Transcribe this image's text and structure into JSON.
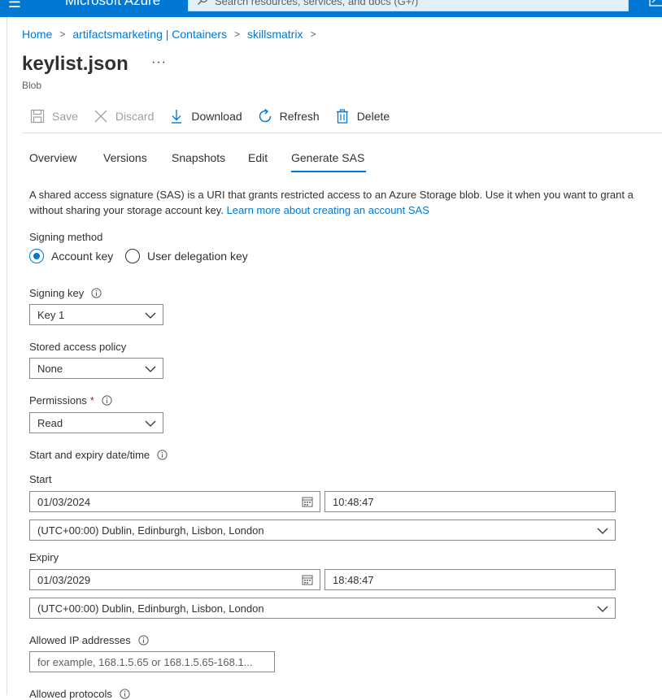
{
  "topbar": {
    "menu_glyph": "☰",
    "brand": "Microsoft Azure",
    "search_placeholder": "Search resources, services, and docs (G+/)",
    "icons": [
      "menu-icon",
      "search-icon",
      "cloud-shell-icon"
    ],
    "color": "#0078d4"
  },
  "breadcrumb": {
    "items": [
      "Home",
      "artifactsmarketing | Containers",
      "skillsmatrix"
    ],
    "separator": ">"
  },
  "header": {
    "title": "keylist.json",
    "more": "···",
    "subtitle": "Blob"
  },
  "toolbar": {
    "save": "Save",
    "discard": "Discard",
    "download": "Download",
    "refresh": "Refresh",
    "delete": "Delete"
  },
  "tabs": {
    "overview": "Overview",
    "versions": "Versions",
    "snapshots": "Snapshots",
    "edit": "Edit",
    "generate_sas": "Generate SAS",
    "active": "Generate SAS"
  },
  "description": {
    "line1": "A shared access signature (SAS) is a URI that grants restricted access to an Azure Storage blob. Use it when you want to grant a",
    "line2_prefix": "without sharing your storage account key. ",
    "link": "Learn more about creating an account SAS"
  },
  "form": {
    "signing_method": {
      "label": "Signing method",
      "options": [
        "Account key",
        "User delegation key"
      ],
      "selected": "Account key"
    },
    "signing_key": {
      "label": "Signing key",
      "value": "Key 1"
    },
    "stored_policy": {
      "label": "Stored access policy",
      "value": "None"
    },
    "permissions": {
      "label": "Permissions",
      "required": "*",
      "value": "Read"
    },
    "datetime": {
      "label": "Start and expiry date/time",
      "start_label": "Start",
      "start_date": "01/03/2024",
      "start_time": "10:48:47",
      "start_tz": "(UTC+00:00) Dublin, Edinburgh, Lisbon, London",
      "expiry_label": "Expiry",
      "expiry_date": "01/03/2029",
      "expiry_time": "18:48:47",
      "expiry_tz": "(UTC+00:00) Dublin, Edinburgh, Lisbon, London"
    },
    "allowed_ip": {
      "label": "Allowed IP addresses",
      "placeholder": "for example, 168.1.5.65 or 168.1.5.65-168.1..."
    },
    "allowed_protocols": {
      "label": "Allowed protocols"
    }
  },
  "colors": {
    "accent": "#0078d4",
    "text": "#323130",
    "muted": "#605e5c",
    "disabled": "#a19f9d",
    "required": "#a4262c",
    "border": "#8a8886"
  }
}
